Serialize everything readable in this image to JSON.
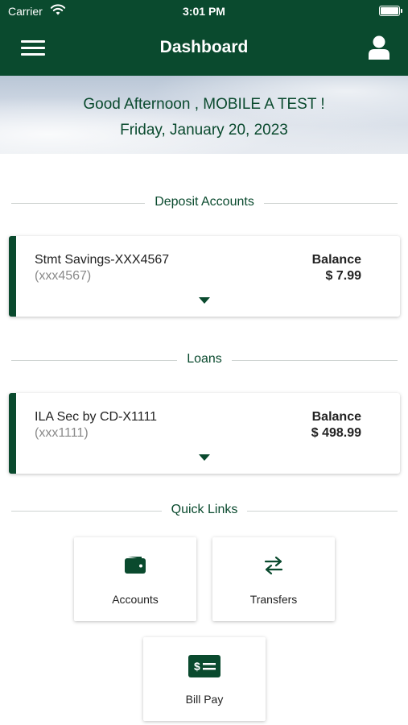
{
  "status_bar": {
    "carrier": "Carrier",
    "time": "3:01 PM"
  },
  "header": {
    "title": "Dashboard"
  },
  "hero": {
    "greeting": "Good Afternoon , MOBILE A TEST !",
    "date": "Friday, January 20, 2023"
  },
  "sections": {
    "deposit": "Deposit Accounts",
    "loans": "Loans",
    "quick_links": "Quick Links"
  },
  "deposit_accounts": [
    {
      "name": "Stmt Savings-XXX4567",
      "number": "(xxx4567)",
      "balance_label": "Balance",
      "balance": "$ 7.99"
    }
  ],
  "loans": [
    {
      "name": "ILA Sec by CD-X1111",
      "number": "(xxx1111)",
      "balance_label": "Balance",
      "balance": "$ 498.99"
    }
  ],
  "quick_links": [
    {
      "label": "Accounts",
      "icon": "wallet-icon"
    },
    {
      "label": "Transfers",
      "icon": "transfer-arrows-icon"
    },
    {
      "label": "Bill Pay",
      "icon": "bill-pay-icon"
    }
  ],
  "colors": {
    "brand": "#0a4a2e",
    "accent_border": "#0a4a2e"
  }
}
